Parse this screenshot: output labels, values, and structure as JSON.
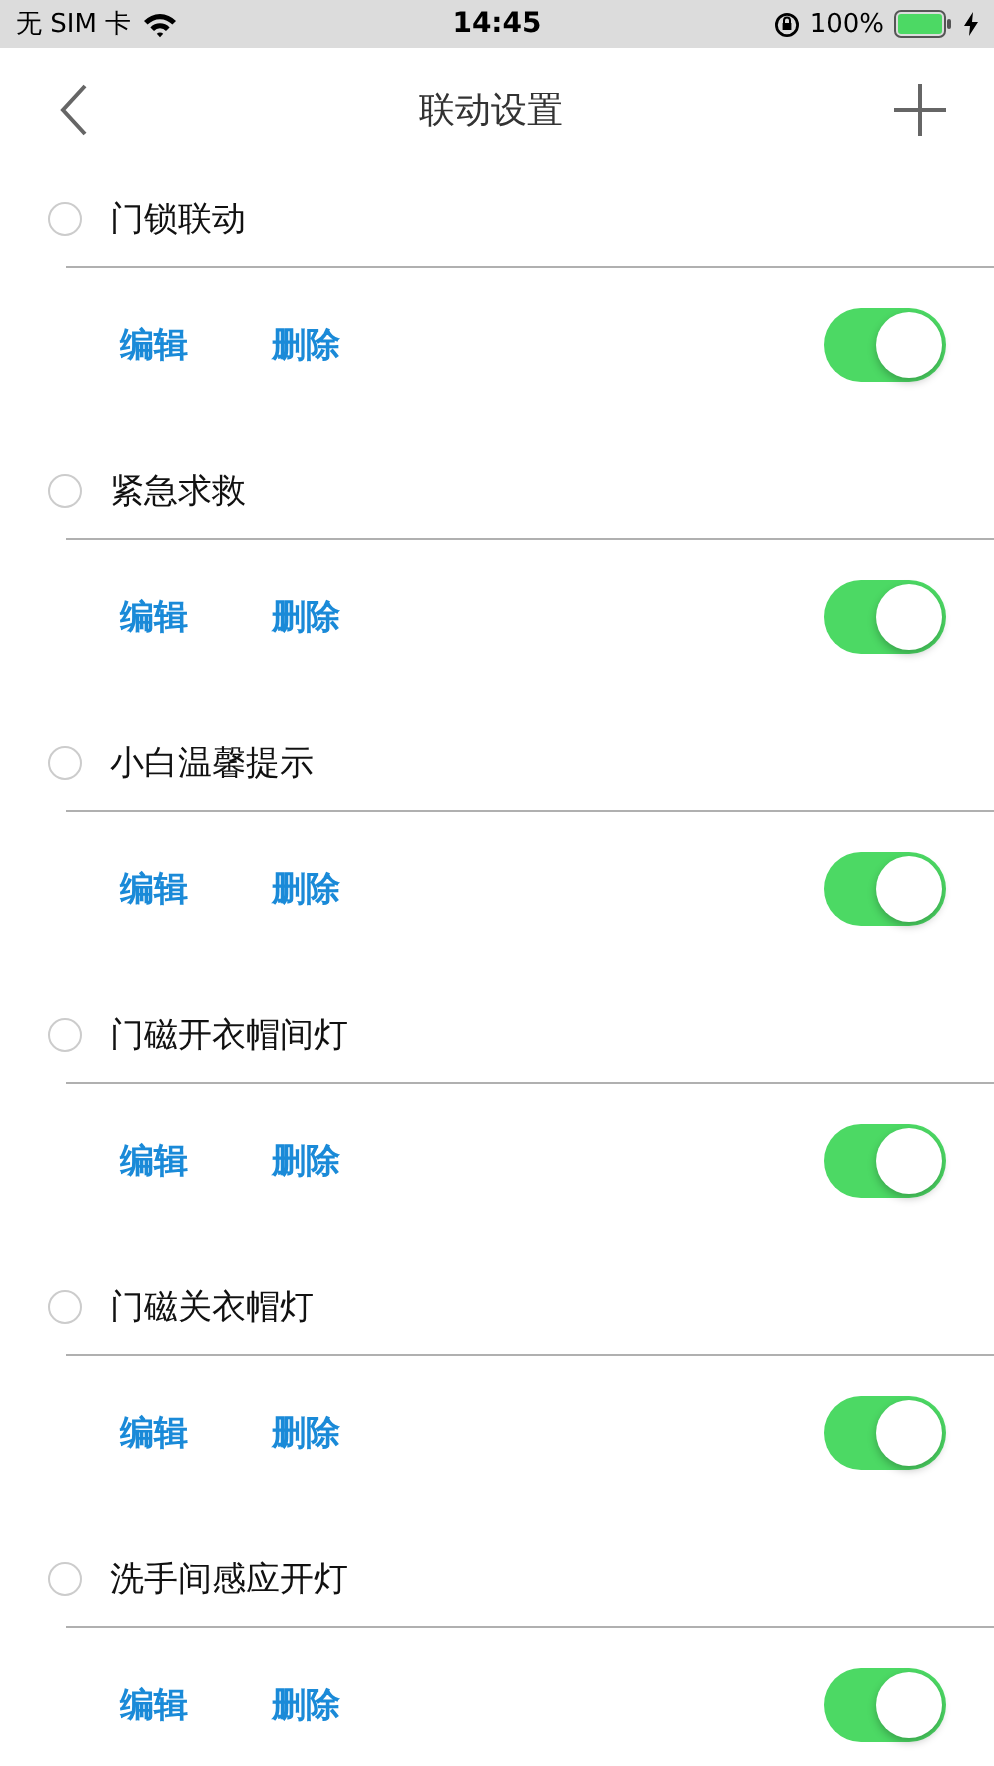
{
  "status_bar": {
    "carrier": "无 SIM 卡",
    "time": "14:45",
    "battery": "100%"
  },
  "nav": {
    "title": "联动设置"
  },
  "items": [
    {
      "name": "门锁联动",
      "selected": false,
      "edit": "编辑",
      "delete": "删除",
      "on": true
    },
    {
      "name": "紧急求救",
      "selected": false,
      "edit": "编辑",
      "delete": "删除",
      "on": true
    },
    {
      "name": "小白温馨提示",
      "selected": false,
      "edit": "编辑",
      "delete": "删除",
      "on": true
    },
    {
      "name": "门磁开衣帽间灯",
      "selected": false,
      "edit": "编辑",
      "delete": "删除",
      "on": true
    },
    {
      "name": "门磁关衣帽灯",
      "selected": false,
      "edit": "编辑",
      "delete": "删除",
      "on": true
    },
    {
      "name": "洗手间感应开灯",
      "selected": false,
      "edit": "编辑",
      "delete": "删除",
      "on": true
    }
  ]
}
